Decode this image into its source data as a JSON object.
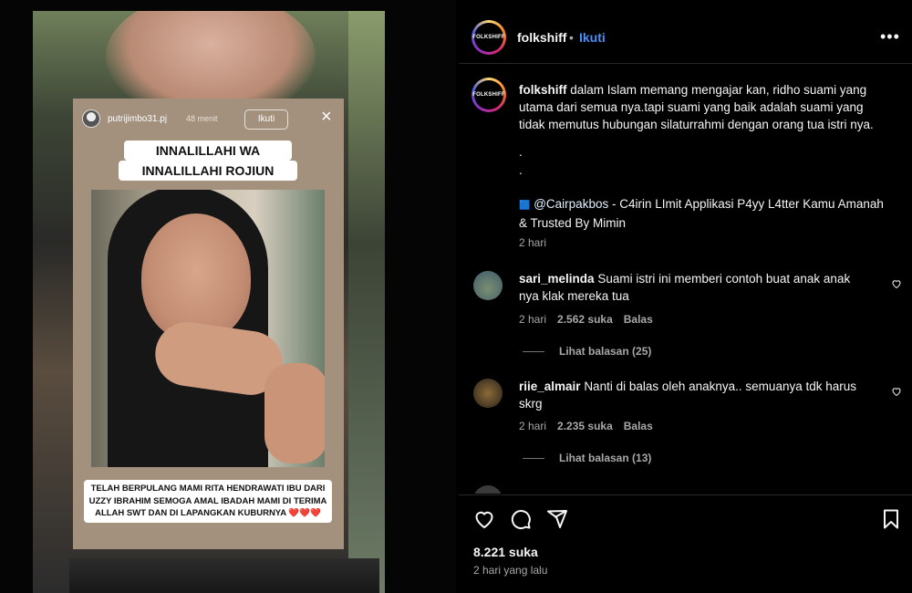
{
  "story": {
    "username": "putrijimbo31.pj",
    "time": "48 menit",
    "follow_label": "Ikuti",
    "close_icon": "×",
    "headline_1": "INNALILLAHI WA",
    "headline_2": "INNALILLAHI ROJIUN",
    "bottom_text": "TELAH BERPULANG MAMI RITA HENDRAWATI IBU DARI UZZY IBRAHIM SEMOGA AMAL IBADAH MAMI DI TERIMA ALLAH SWT DAN DI LAPANGKAN KUBURNYA ❤️❤️❤️"
  },
  "post": {
    "avatar_text": "FOLKSHIFF",
    "username": "folkshiff",
    "dot": "•",
    "follow_label": "Ikuti",
    "more_icon": "•••",
    "caption_text": "dalam Islam memang mengajar kan, ridho suami yang utama dari semua nya.tapi suami yang baik adalah suami yang tidak memutus hubungan silaturrahmi dengan orang tua istri nya.",
    "dot_line_1": ".",
    "dot_line_2": ".",
    "promo_emoji": "🟦",
    "promo_mention": "@Cairpakbos",
    "promo_text": " - C4irin LImit Applikasi P4yy L4tter Kamu Amanah & Trusted By Mimin",
    "caption_time": "2 hari"
  },
  "comments": [
    {
      "username": "sari_melinda",
      "text": "Suami istri ini memberi contoh buat anak anak nya klak mereka tua",
      "time": "2 hari",
      "likes": "2.562 suka",
      "reply_label": "Balas",
      "view_replies": "Lihat balasan (25)"
    },
    {
      "username": "riie_almair",
      "text": "Nanti di balas oleh anaknya.. semuanya tdk harus skrg",
      "time": "2 hari",
      "likes": "2.235 suka",
      "reply_label": "Balas",
      "view_replies": "Lihat balasan (13)"
    }
  ],
  "actions": {
    "like_icon": "heart-icon",
    "comment_icon": "comment-icon",
    "share_icon": "share-icon",
    "save_icon": "bookmark-icon",
    "likes_count": "8.221 suka",
    "posted_time": "2 hari yang lalu"
  },
  "colors": {
    "background": "#000000",
    "follow_blue": "#4a8ff7",
    "muted": "#a8a8a8",
    "story_bg": "#a4917d"
  }
}
